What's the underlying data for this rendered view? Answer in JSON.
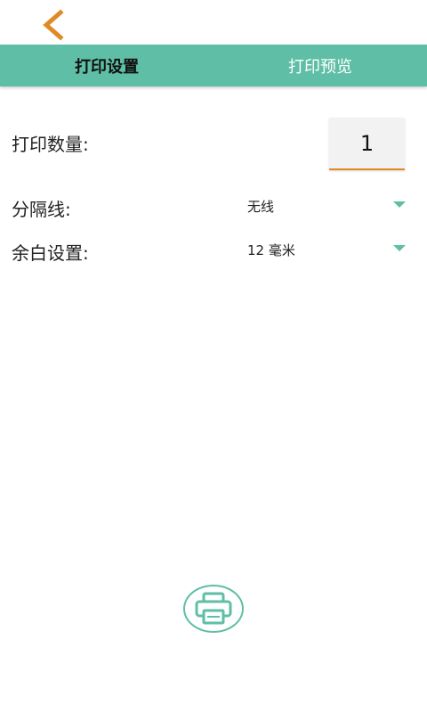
{
  "header": {
    "back_icon": "chevron-left-icon",
    "accent_color": "#e08a27"
  },
  "tabs": [
    {
      "label": "打印设置",
      "active": true
    },
    {
      "label": "打印预览",
      "active": false
    }
  ],
  "theme": {
    "primary": "#5fbea6",
    "accent": "#e08a27"
  },
  "form": {
    "quantity": {
      "label": "打印数量:",
      "value": "1"
    },
    "divider": {
      "label": "分隔线:",
      "value": "无线"
    },
    "margin": {
      "label": "余白设置:",
      "value": "12 毫米"
    }
  },
  "actions": {
    "print_icon": "printer-icon"
  }
}
